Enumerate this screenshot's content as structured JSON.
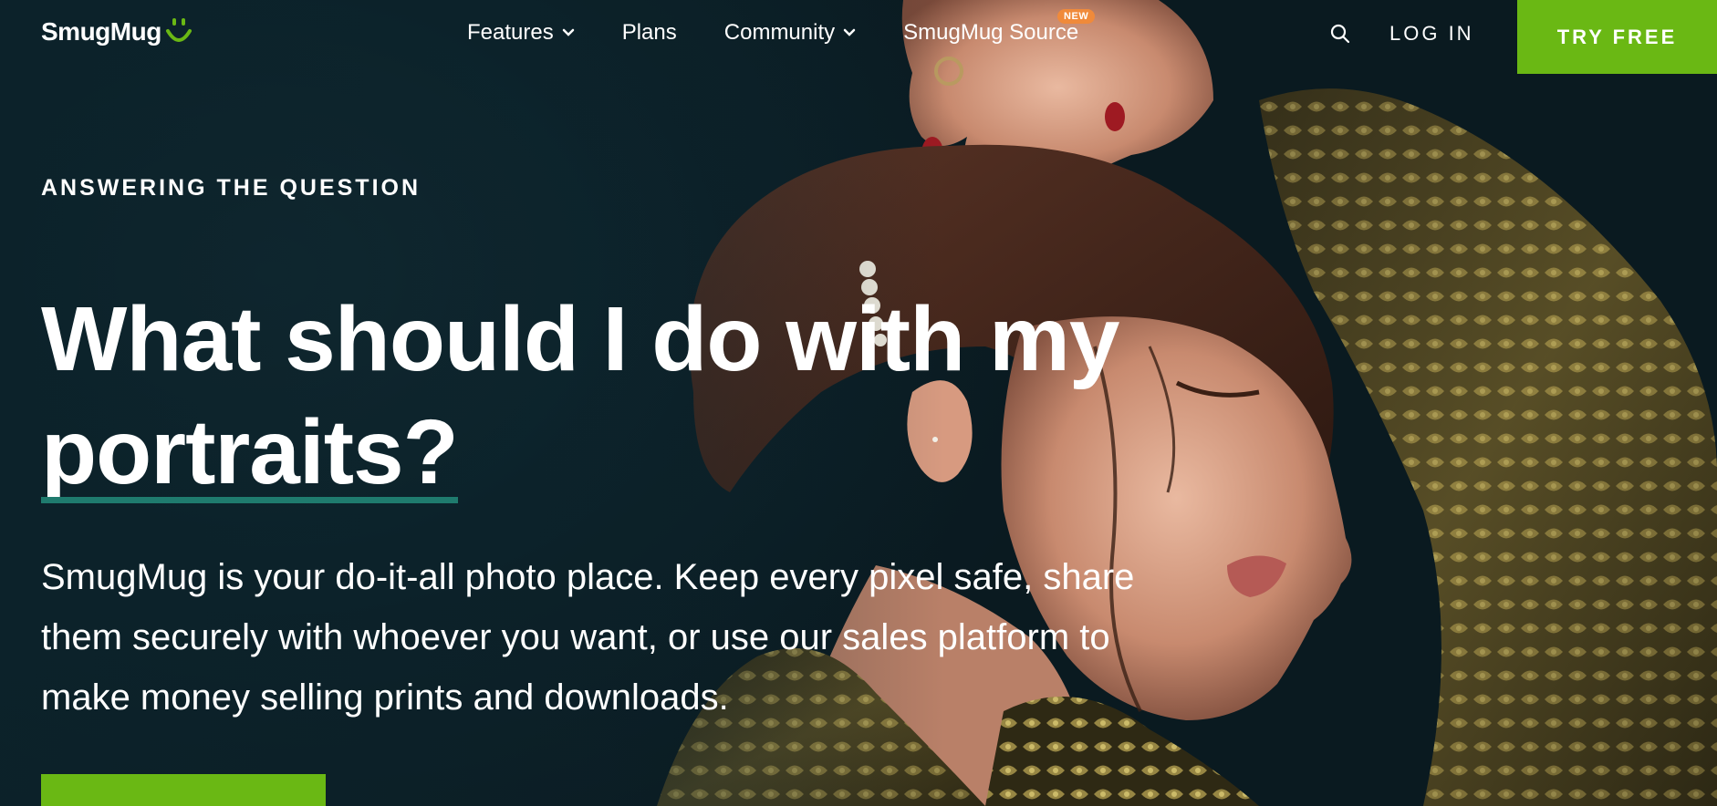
{
  "nav": {
    "logo_text": "SmugMug",
    "items": [
      {
        "label": "Features",
        "has_dropdown": true
      },
      {
        "label": "Plans",
        "has_dropdown": false
      },
      {
        "label": "Community",
        "has_dropdown": true
      },
      {
        "label": "SmugMug Source",
        "has_dropdown": false,
        "badge": "NEW"
      }
    ],
    "search_icon": "search-icon",
    "login_label": "LOG IN",
    "try_free_label": "TRY FREE"
  },
  "hero": {
    "eyebrow": "ANSWERING THE QUESTION",
    "headline_line1": "What should I do with my",
    "headline_line2": "portraits?",
    "subcopy": "SmugMug is your do-it-all photo place. Keep every pixel safe, share them securely with whoever you want, or use our sales platform to make money selling prints and downloads.",
    "cta_label": ""
  },
  "colors": {
    "accent_green": "#6ab814",
    "badge_orange": "#f08a3a",
    "underline_teal": "#1f7b6e",
    "background": "#0c222a"
  }
}
